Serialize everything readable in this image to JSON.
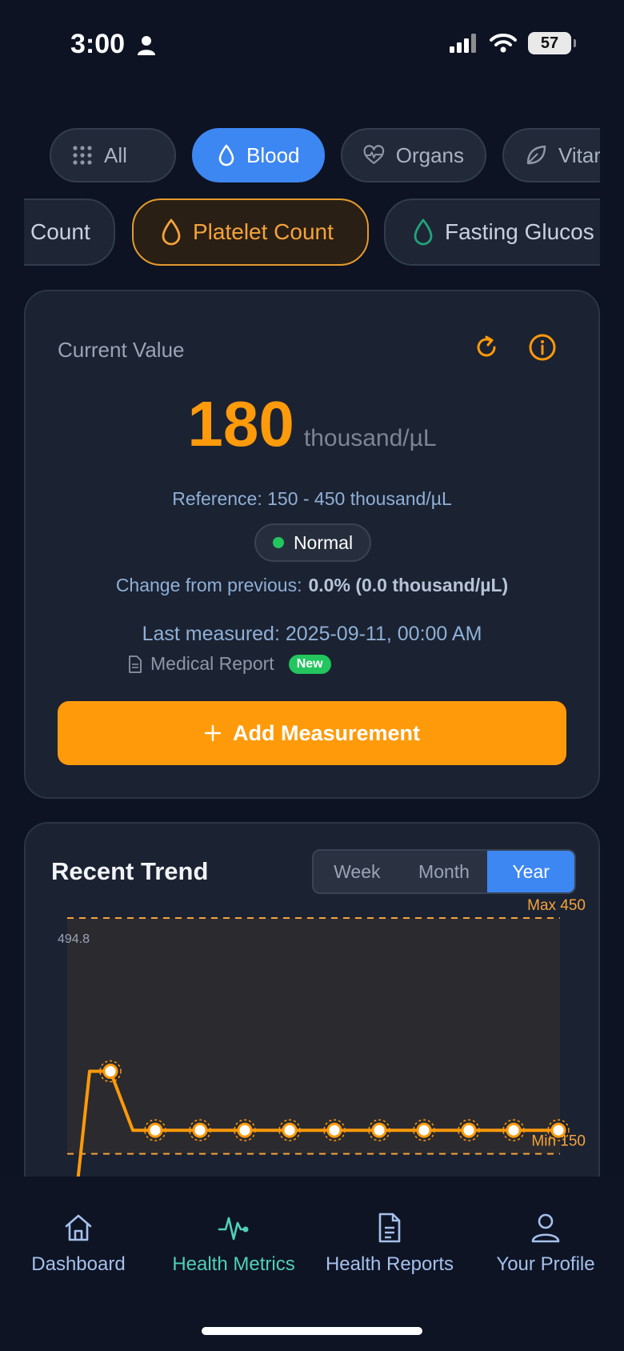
{
  "status_bar": {
    "time": "3:00",
    "battery": "57"
  },
  "categories": [
    {
      "label": "All",
      "icon": "grid-icon",
      "active": false
    },
    {
      "label": "Blood",
      "icon": "droplet-icon",
      "active": true
    },
    {
      "label": "Organs",
      "icon": "heart-pulse-icon",
      "active": false
    },
    {
      "label": "Vitar",
      "icon": "leaf-icon",
      "active": false
    }
  ],
  "metrics": [
    {
      "label": "Count",
      "active": false
    },
    {
      "label": "Platelet Count",
      "icon": "droplet-icon",
      "active": true
    },
    {
      "label": "Fasting Glucos",
      "icon": "droplet-icon",
      "active": false
    }
  ],
  "current": {
    "label": "Current Value",
    "value": "180",
    "unit": "thousand/µL",
    "reference": "Reference: 150 - 450 thousand/µL",
    "status": "Normal",
    "change_label": "Change from previous:",
    "change_value": "0.0% (0.0 thousand/µL)",
    "last_measured": "Last measured: 2025-09-11, 00:00 AM",
    "source": "Medical Report",
    "source_badge": "New",
    "add_button": "Add Measurement",
    "colors": {
      "accent": "#ff9a0a",
      "normal": "#22c55e"
    }
  },
  "trend": {
    "title": "Recent Trend",
    "ranges": [
      "Week",
      "Month",
      "Year"
    ],
    "active_range": "Year"
  },
  "chart_data": {
    "type": "line",
    "y_top_label": "494.8",
    "max_label": "Max 450",
    "min_label": "Min 150",
    "reference_range": [
      150,
      450
    ],
    "ylim": [
      0,
      494.8
    ],
    "series": [
      {
        "values": [
          255,
          180,
          180,
          180,
          180,
          180,
          180,
          180,
          180,
          180,
          180
        ]
      }
    ]
  },
  "nav": [
    {
      "label": "Dashboard",
      "icon": "home-icon",
      "active": false
    },
    {
      "label": "Health Metrics",
      "icon": "activity-icon",
      "active": true
    },
    {
      "label": "Health Reports",
      "icon": "document-icon",
      "active": false
    },
    {
      "label": "Your Profile",
      "icon": "user-icon",
      "active": false
    }
  ]
}
